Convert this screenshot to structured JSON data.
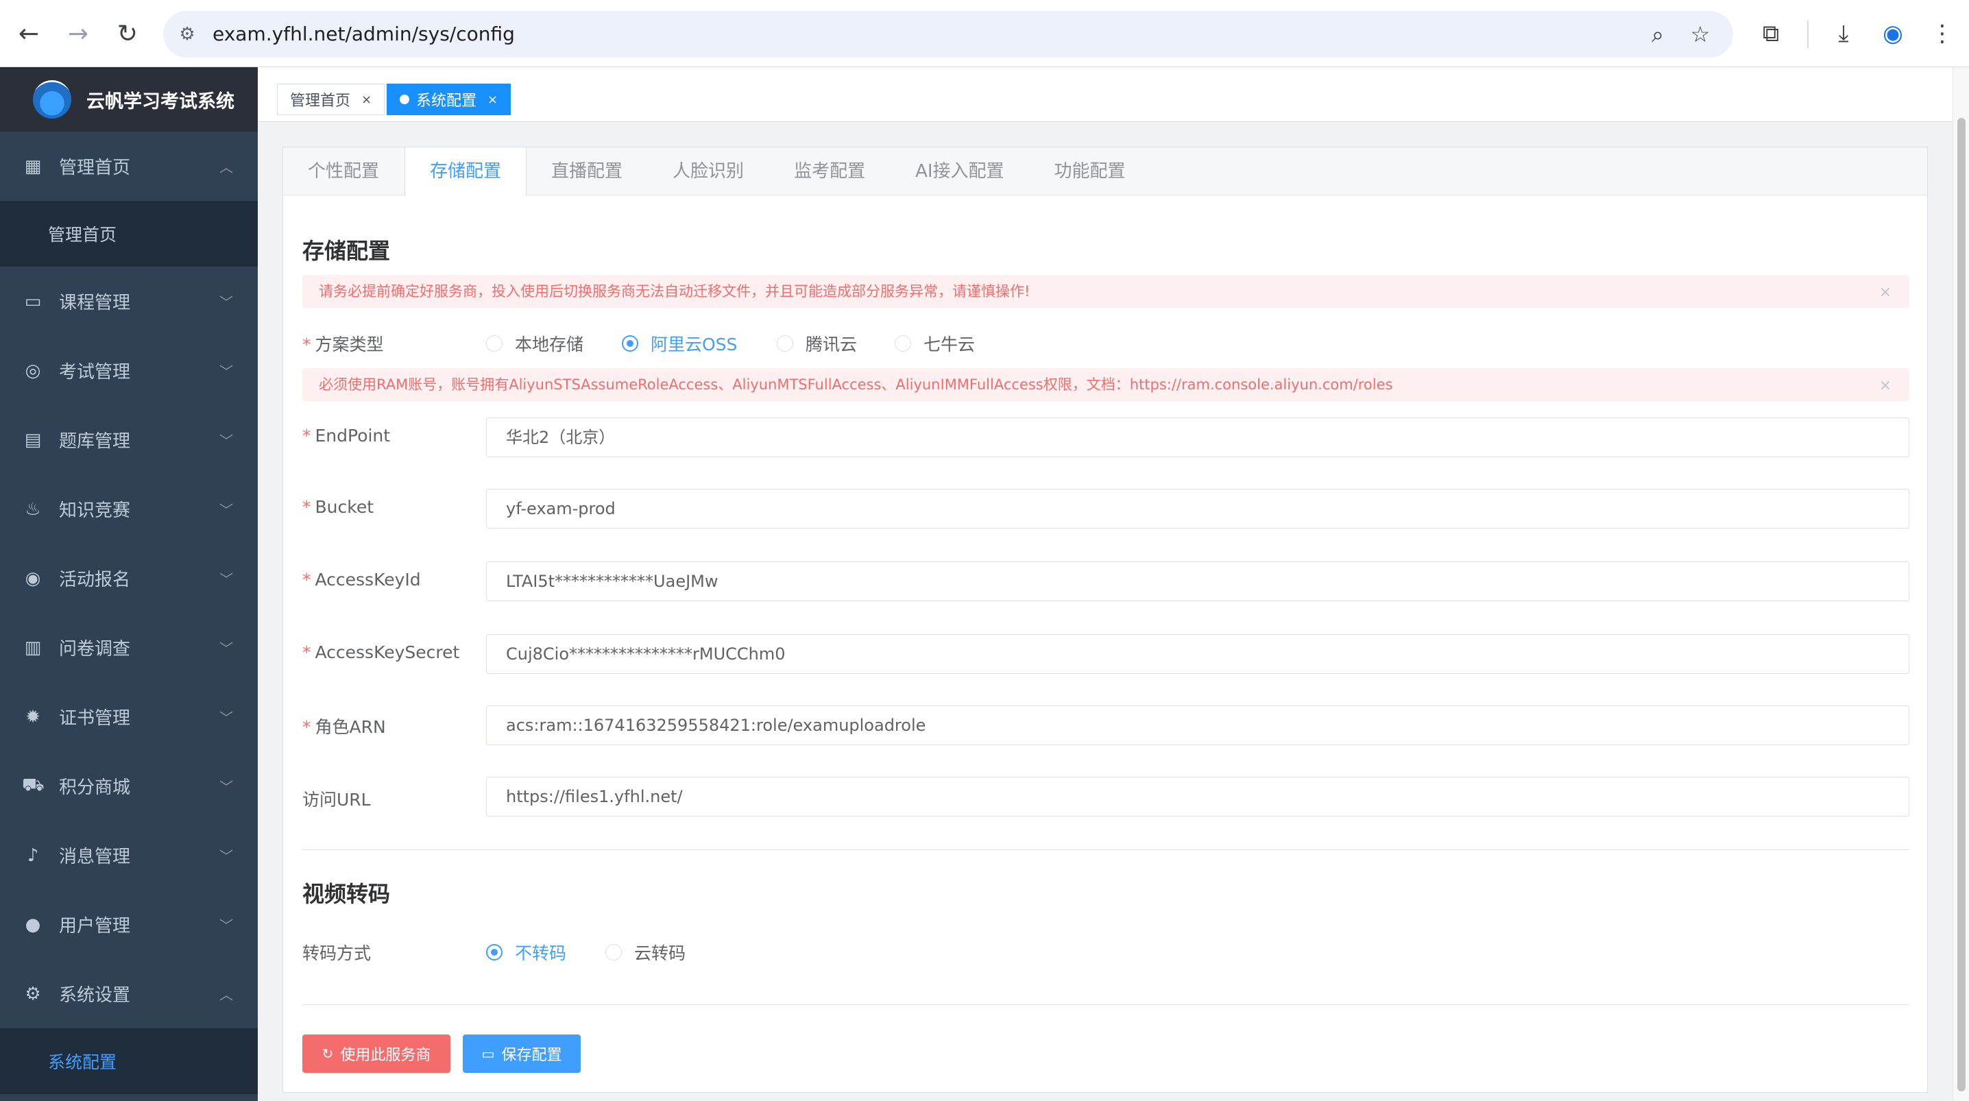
{
  "browser": {
    "url": "exam.yfhl.net/admin/sys/config"
  },
  "sidebar": {
    "app_title": "云帆学习考试系统",
    "items": [
      {
        "label": "管理首页",
        "icon": "dashboard-icon"
      },
      {
        "label": "课程管理",
        "icon": "course-icon"
      },
      {
        "label": "考试管理",
        "icon": "exam-icon"
      },
      {
        "label": "题库管理",
        "icon": "question-bank-icon"
      },
      {
        "label": "知识竞赛",
        "icon": "fire-icon"
      },
      {
        "label": "活动报名",
        "icon": "activity-icon"
      },
      {
        "label": "问卷调查",
        "icon": "survey-icon"
      },
      {
        "label": "证书管理",
        "icon": "certificate-icon"
      },
      {
        "label": "积分商城",
        "icon": "cart-icon"
      },
      {
        "label": "消息管理",
        "icon": "bell-icon"
      },
      {
        "label": "用户管理",
        "icon": "user-icon"
      },
      {
        "label": "系统设置",
        "icon": "gear-icon"
      }
    ],
    "sub_home": "管理首页",
    "sub_config": "系统配置"
  },
  "tags": {
    "home": "管理首页",
    "config": "系统配置"
  },
  "tabs": [
    "个性配置",
    "存储配置",
    "直播配置",
    "人脸识别",
    "监考配置",
    "AI接入配置",
    "功能配置"
  ],
  "storage": {
    "title": "存储配置",
    "warning": "请务必提前确定好服务商，投入使用后切换服务商无法自动迁移文件，并且可能造成部分服务异常，请谨慎操作!",
    "scheme_label": "方案类型",
    "scheme_options": [
      "本地存储",
      "阿里云OSS",
      "腾讯云",
      "七牛云"
    ],
    "scheme_selected": "阿里云OSS",
    "ram_notice": "必须使用RAM账号，账号拥有AliyunSTSAssumeRoleAccess、AliyunMTSFullAccess、AliyunIMMFullAccess权限，文档：https://ram.console.aliyun.com/roles",
    "fields": [
      {
        "label": "EndPoint",
        "value": "华北2（北京）",
        "required": true
      },
      {
        "label": "Bucket",
        "value": "yf-exam-prod",
        "required": true
      },
      {
        "label": "AccessKeyId",
        "value": "LTAI5t************UaeJMw",
        "required": true
      },
      {
        "label": "AccessKeySecret",
        "value": "Cuj8Cio***************rMUCChm0",
        "required": true
      },
      {
        "label": "角色ARN",
        "value": "acs:ram::1674163259558421:role/examuploadrole",
        "required": true
      },
      {
        "label": "访问URL",
        "value": "https://files1.yfhl.net/",
        "required": false
      }
    ]
  },
  "video": {
    "title": "视频转码",
    "mode_label": "转码方式",
    "options": [
      "不转码",
      "云转码"
    ],
    "selected": "不转码"
  },
  "buttons": {
    "use_provider": "使用此服务商",
    "save": "保存配置"
  },
  "colors": {
    "sidebar_bg": "#304156",
    "accent": "#409eff",
    "danger": "#f56c6c"
  }
}
